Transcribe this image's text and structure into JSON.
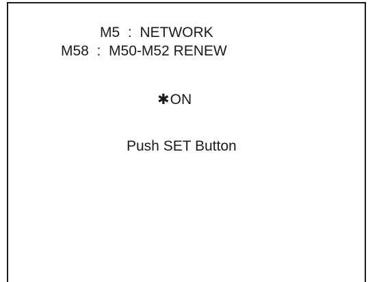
{
  "menu": {
    "current": "M5  :  NETWORK",
    "item": "M58  :  M50-M52 RENEW"
  },
  "option": {
    "marker_icon": "asterisk-icon",
    "marker_glyph": "✱",
    "value": "ON"
  },
  "prompt": {
    "text": "Push SET Button"
  },
  "colors": {
    "text": "#1a1a1a",
    "background": "#ffffff",
    "frame": "#1a1a1a"
  }
}
